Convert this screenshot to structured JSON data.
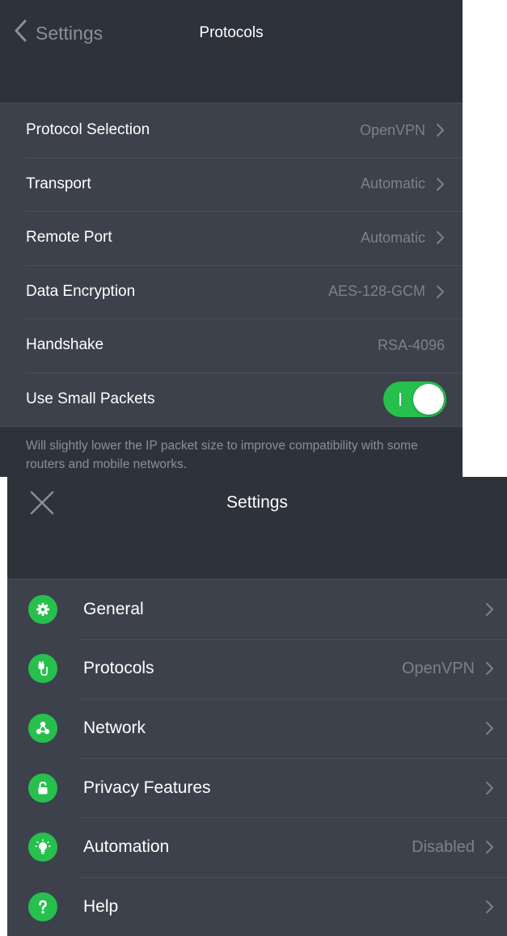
{
  "colors": {
    "background": "#2e323b",
    "list_background": "#3d414b",
    "separator": "#4b4f59",
    "accent_green": "#27c04d",
    "secondary_text": "#7c818b"
  },
  "protocols_screen": {
    "back_label": "Settings",
    "title": "Protocols",
    "rows": [
      {
        "label": "Protocol Selection",
        "value": "OpenVPN"
      },
      {
        "label": "Transport",
        "value": "Automatic"
      },
      {
        "label": "Remote Port",
        "value": "Automatic"
      },
      {
        "label": "Data Encryption",
        "value": "AES-128-GCM"
      },
      {
        "label": "Handshake",
        "value": "RSA-4096"
      },
      {
        "label": "Use Small Packets",
        "toggle_on": true
      }
    ],
    "footnote": "Will slightly lower the IP packet size to improve compatibility with some routers and mobile networks."
  },
  "settings_screen": {
    "title": "Settings",
    "rows": [
      {
        "label": "General",
        "value": "",
        "icon": "gear-icon"
      },
      {
        "label": "Protocols",
        "value": "OpenVPN",
        "icon": "plug-icon"
      },
      {
        "label": "Network",
        "value": "",
        "icon": "network-icon"
      },
      {
        "label": "Privacy Features",
        "value": "",
        "icon": "lock-icon"
      },
      {
        "label": "Automation",
        "value": "Disabled",
        "icon": "lightbulb-icon"
      },
      {
        "label": "Help",
        "value": "",
        "icon": "question-icon"
      }
    ]
  }
}
